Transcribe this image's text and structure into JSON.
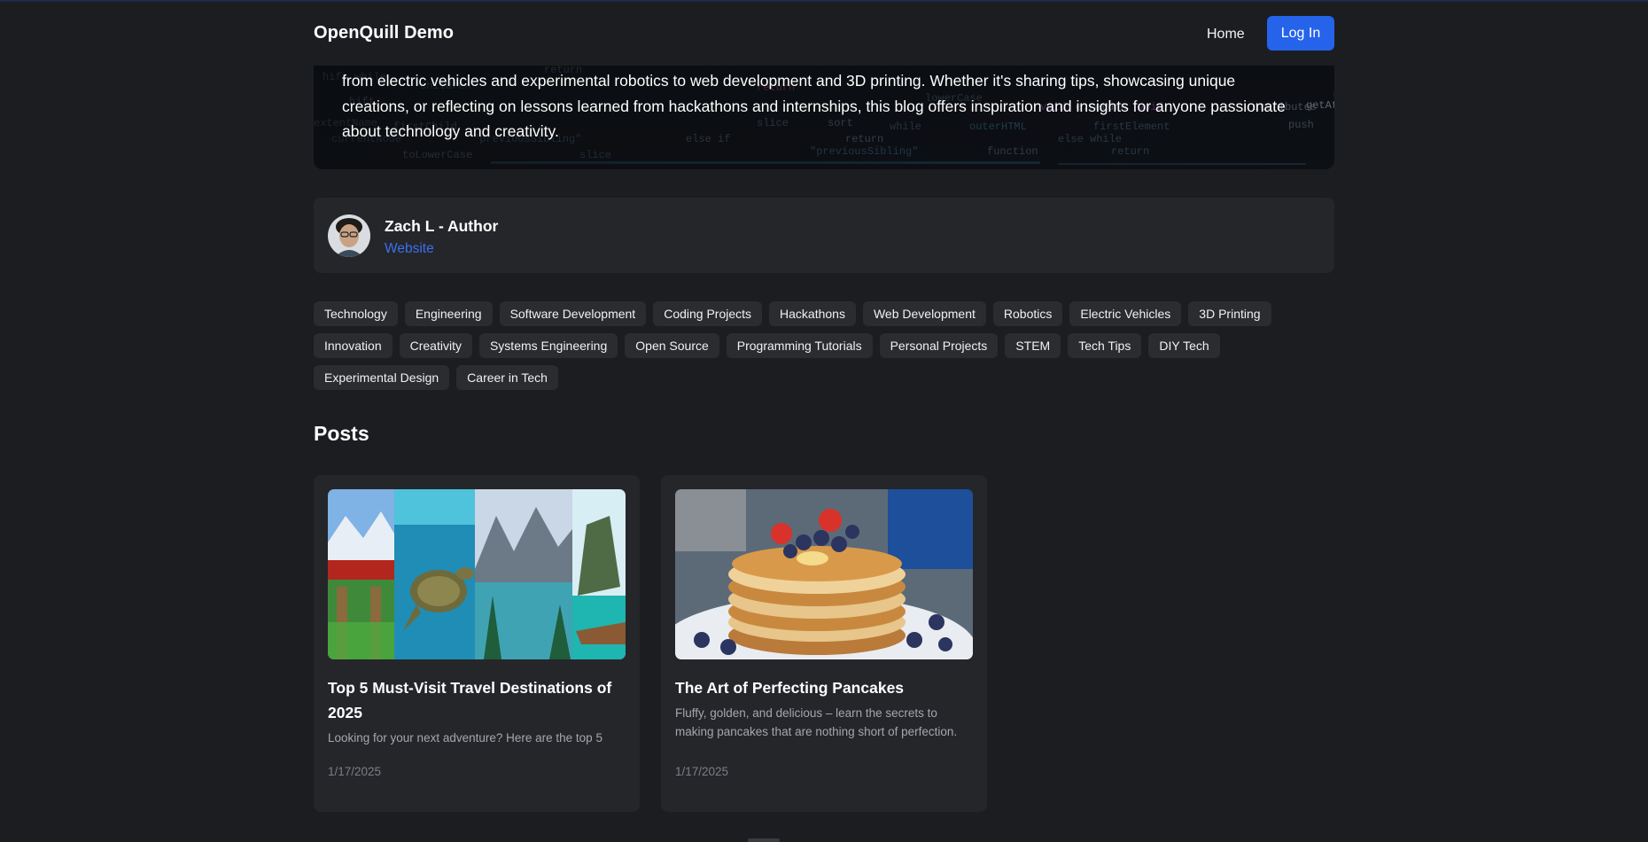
{
  "header": {
    "brand": "OpenQuill Demo",
    "nav_home": "Home",
    "login_label": "Log In",
    "accent_color": "#2563eb"
  },
  "hero": {
    "description": "from electric vehicles and experimental robotics to web development and 3D printing. Whether it's sharing tips, showcasing unique creations, or reflecting on lessons learned from hackathons and internships, this blog offers inspiration and insights for anyone passionate about technology and creativity."
  },
  "author": {
    "name": "Zach L - Author",
    "link_label": "Website",
    "link_color": "#3b6ff0"
  },
  "tags": [
    "Technology",
    "Engineering",
    "Software Development",
    "Coding Projects",
    "Hackathons",
    "Web Development",
    "Robotics",
    "Electric Vehicles",
    "3D Printing",
    "Innovation",
    "Creativity",
    "Systems Engineering",
    "Open Source",
    "Programming Tutorials",
    "Personal Projects",
    "STEM",
    "Tech Tips",
    "DIY Tech",
    "Experimental Design",
    "Career in Tech"
  ],
  "posts_section": {
    "title": "Posts",
    "posts": [
      {
        "title": "Top 5 Must-Visit Travel Destinations of 2025",
        "excerpt": "Looking for your next adventure? Here are the top 5",
        "date": "1/17/2025",
        "image": "travel-collage"
      },
      {
        "title": "The Art of Perfecting Pancakes",
        "excerpt": "Fluffy, golden, and delicious – learn the secrets to making pancakes that are nothing short of perfection.",
        "date": "1/17/2025",
        "image": "pancake-stack"
      }
    ]
  }
}
